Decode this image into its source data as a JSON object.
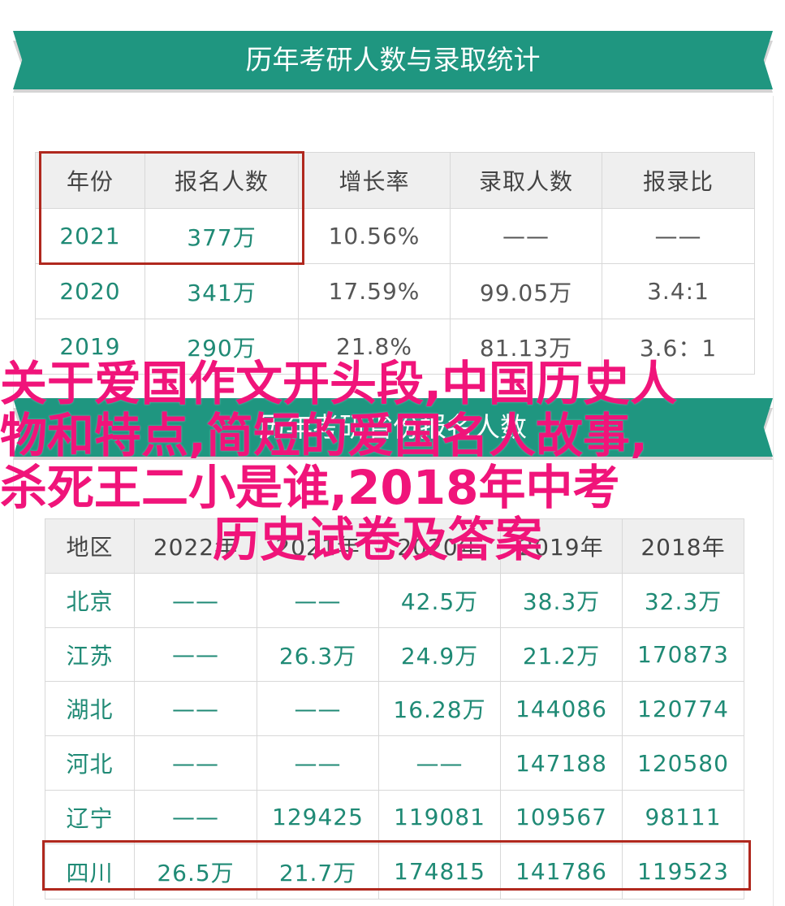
{
  "banner1": {
    "title": "历年考研人数与录取统计"
  },
  "banner2": {
    "title": "历年考研省份报名人数"
  },
  "table1": {
    "headers": [
      "年份",
      "报名人数",
      "增长率",
      "录取人数",
      "报录比"
    ],
    "rows": [
      [
        "2021",
        "377万",
        "10.56%",
        "——",
        "——"
      ],
      [
        "2020",
        "341万",
        "17.59%",
        "99.05万",
        "3.4:1"
      ],
      [
        "2019",
        "290万",
        "21.8%",
        "81.13万",
        "3.6：1"
      ]
    ]
  },
  "table2": {
    "headers": [
      "地区",
      "2022年",
      "2021年",
      "2020年",
      "2019年",
      "2018年"
    ],
    "rows": [
      [
        "北京",
        "——",
        "——",
        "42.5万",
        "38.3万",
        "32.3万"
      ],
      [
        "江苏",
        "——",
        "26.3万",
        "24.9万",
        "21.2万",
        "170873"
      ],
      [
        "湖北",
        "——",
        "——",
        "16.28万",
        "144086",
        "120774"
      ],
      [
        "河北",
        "——",
        "——",
        "——",
        "147188",
        "120580"
      ],
      [
        "辽宁",
        "——",
        "129425",
        "119081",
        "109567",
        "98111"
      ],
      [
        "四川",
        "26.5万",
        "21.7万",
        "174815",
        "141786",
        "119523"
      ]
    ]
  },
  "overlay": {
    "line1": "关于爱国作文开头段,中国历史人",
    "line2": "物和特点,简短的爱国名人故事,",
    "line3": "杀死王二小是谁,2018年中考",
    "line4": "历史试卷及答案"
  },
  "colors": {
    "accent_green": "#1f9680",
    "highlight_red": "#b0281e",
    "overlay_pink": "#f0147a"
  }
}
